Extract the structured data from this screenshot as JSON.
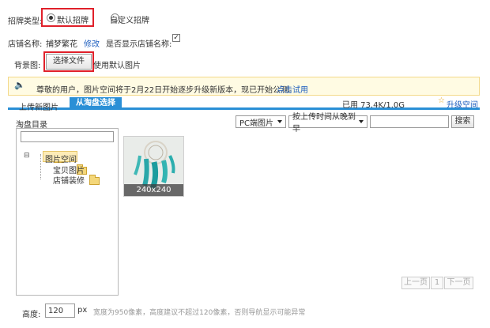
{
  "signboard": {
    "type_label": "招牌类型:",
    "option_default": "默认招牌",
    "option_custom": "自定义招牌"
  },
  "shop": {
    "name_label": "店铺名称:",
    "name_value": "捕梦繁花",
    "edit_link": "修改",
    "show_name_label": "是否显示店铺名称:",
    "show_name_mark": "✓"
  },
  "background": {
    "label": "背景图:",
    "choose_button": "选择文件",
    "default_text": "使用默认图片"
  },
  "notice": {
    "text": "尊敬的用户，图片空间将于2月22日开始逐步升级新版本，现已开始公测。",
    "link": "点击试用"
  },
  "tabs": {
    "upload": "上传新图片",
    "choose": "从淘盘选择",
    "usage": "已用 73.4K/1.0G",
    "upgrade": "升级空间"
  },
  "folder_panel": {
    "title": "淘盘目录",
    "root": "图片空间",
    "children": [
      "宝贝图片",
      "店铺装修"
    ],
    "expander": "⊟"
  },
  "filters": {
    "device": "PC端图片",
    "sort": "按上传时间从晚到早",
    "search_button": "搜索"
  },
  "gallery": {
    "thumb_label": "240x240"
  },
  "pager": {
    "prev": "上一页",
    "page": "1",
    "next": "下一页"
  },
  "height": {
    "label": "高度:",
    "value": "120",
    "unit": "px",
    "hint": "宽度为950像素，高度建议不超过120像素，否则导航显示可能异常"
  },
  "colors": {
    "accent": "#2a8fd6",
    "highlight": "#e0202a",
    "link": "#1f5fbf"
  }
}
